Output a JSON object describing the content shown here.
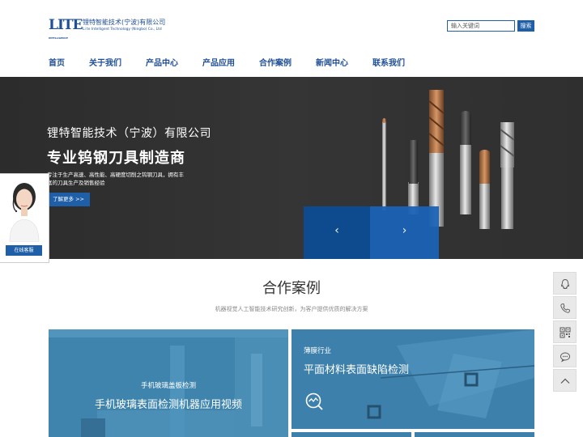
{
  "header": {
    "logo_mark": "LITE",
    "logo_mark_sub": "INTELLIGENCE",
    "company_cn": "锂特智能技术(宁波)有限公司",
    "company_en": "Li te Intelligent Technology (Ningbo) Co., Ltd",
    "search_placeholder": "输入关键词",
    "search_button": "搜索"
  },
  "nav": {
    "items": [
      {
        "label": "首页"
      },
      {
        "label": "关于我们"
      },
      {
        "label": "产品中心"
      },
      {
        "label": "产品应用"
      },
      {
        "label": "合作案例"
      },
      {
        "label": "新闻中心"
      },
      {
        "label": "联系我们"
      }
    ]
  },
  "banner": {
    "company": "锂特智能技术（宁波）有限公司",
    "title": "专业钨钢刀具制造商",
    "description": "专注于生产高速、高性能、高硬度切削之钨钢刀具，拥有丰富的刀具生产及销售经验",
    "more_button": "了解更多 >>",
    "prev_arrow": "‹",
    "next_arrow": "›"
  },
  "chat": {
    "button": "在线客服"
  },
  "cases": {
    "title": "合作案例",
    "subtitle": "机器视觉人工智能技术研究创新，为客户提供优质的解决方案",
    "items": [
      {
        "category": "手机玻璃盖板检测",
        "title": "手机玻璃表面检测机器应用视频"
      },
      {
        "category": "薄膜行业",
        "title": "平面材料表面缺陷检测"
      }
    ]
  },
  "sidebar": {
    "icons": [
      "qq-icon",
      "phone-icon",
      "qrcode-icon",
      "message-icon",
      "back-to-top-icon"
    ]
  },
  "colors": {
    "brand_blue": "#1f5fa8",
    "nav_blue": "#1f4f95",
    "case_blue": "#3d80ab",
    "banner_dark": "#2f2f2f"
  }
}
